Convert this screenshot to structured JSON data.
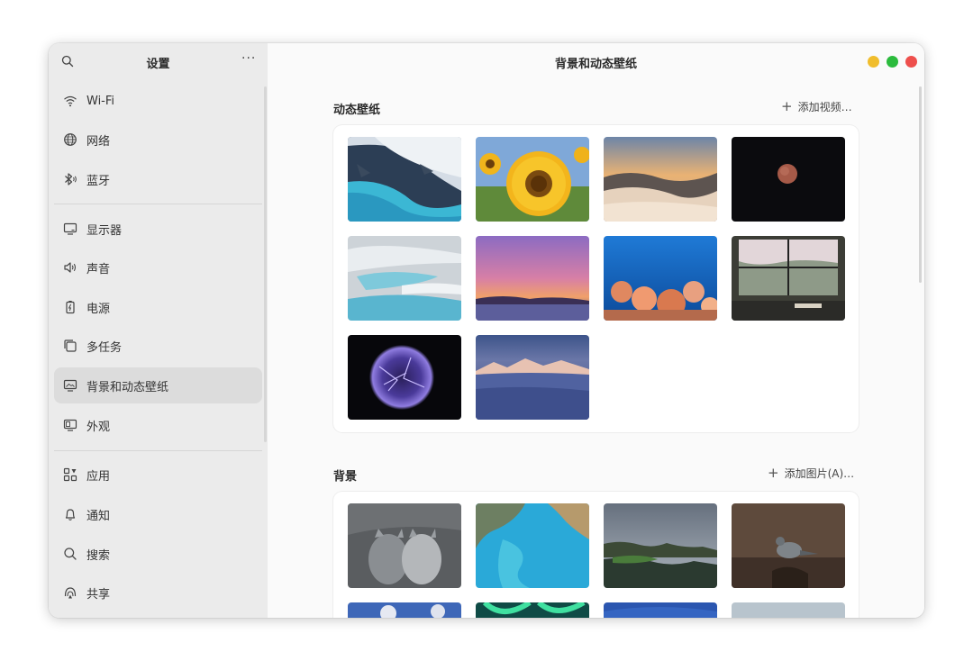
{
  "sidebar": {
    "title": "设置",
    "more": "···",
    "items": [
      {
        "label": "Wi-Fi",
        "icon": "wifi-icon"
      },
      {
        "label": "网络",
        "icon": "globe-icon"
      },
      {
        "label": "蓝牙",
        "icon": "bluetooth-icon"
      },
      {
        "label": "显示器",
        "icon": "monitor-icon"
      },
      {
        "label": "声音",
        "icon": "speaker-icon"
      },
      {
        "label": "电源",
        "icon": "battery-icon"
      },
      {
        "label": "多任务",
        "icon": "multitask-icon"
      },
      {
        "label": "背景和动态壁纸",
        "icon": "wallpaper-icon",
        "active": true
      },
      {
        "label": "外观",
        "icon": "appearance-icon"
      },
      {
        "label": "应用",
        "icon": "apps-icon"
      },
      {
        "label": "通知",
        "icon": "bell-icon"
      },
      {
        "label": "搜索",
        "icon": "search-icon"
      },
      {
        "label": "共享",
        "icon": "share-icon"
      }
    ]
  },
  "main": {
    "title": "背景和动态壁纸",
    "dynamic": {
      "title": "动态壁纸",
      "add_label": "添加视频…",
      "thumbnails": [
        "glacier-river",
        "sunflower",
        "sunset-clouds",
        "planet-space",
        "salt-terraces",
        "purple-sunset",
        "coral-reef",
        "window-garden",
        "plasma-orb",
        "snowy-mountains"
      ]
    },
    "background": {
      "title": "背景",
      "add_label": "添加图片(A)…",
      "thumbnails": [
        "kittens",
        "turquoise-coast",
        "mossy-rocks",
        "sparrow",
        "flowers-sky",
        "aurora",
        "blue-night",
        "misty-lake"
      ]
    }
  },
  "colors": {
    "close": "#ee4f4c",
    "maximize": "#2bbb3d",
    "minimize": "#f0bd2c",
    "sidebar_active": "#dcdcdc"
  }
}
